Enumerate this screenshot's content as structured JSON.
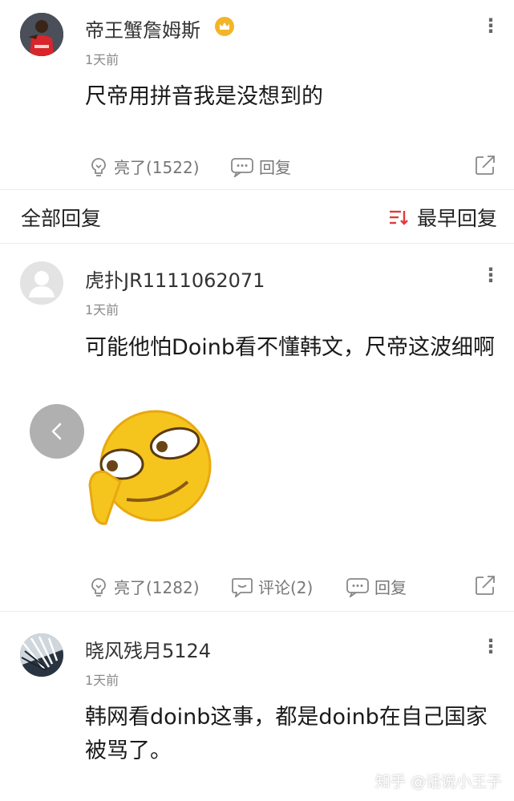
{
  "post": {
    "username": "帝王蟹詹姆斯",
    "time": "1天前",
    "text": "尺帝用拼音我是没想到的",
    "like_label": "亮了(1522)",
    "reply_label": "回复"
  },
  "replies_header": {
    "title": "全部回复",
    "sort_label": "最早回复",
    "sort_icon_color": "#e03a3a"
  },
  "replies": [
    {
      "username": "虎扑JR1111062071",
      "time": "1天前",
      "text": "可能他怕Doinb看不懂韩文，尺帝这波细啊",
      "like_label": "亮了(1282)",
      "comment_label": "评论(2)",
      "reply_label": "回复",
      "sticker": "smirking-emoji-sticker"
    },
    {
      "username": "晓风残月5124",
      "time": "1天前",
      "text": "韩网看doinb这事，都是doinb在自己国家被骂了。"
    }
  ],
  "watermark": "知乎 @话说小王子",
  "icons": {
    "more": "more-vertical-icon",
    "like": "lightbulb-icon",
    "reply": "chat-bubble-icon",
    "comment": "comment-icon",
    "share": "share-icon",
    "back": "chevron-left-icon",
    "badge": "crown-badge-icon"
  },
  "colors": {
    "badge": "#f2b52a",
    "emoji": "#f5c51e"
  }
}
